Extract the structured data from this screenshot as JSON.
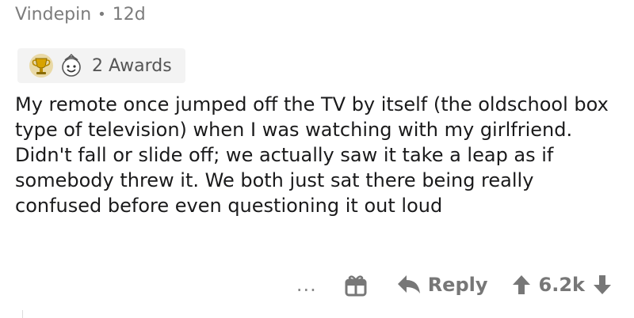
{
  "comment": {
    "author": "Vindepin",
    "separator": "•",
    "age": "12d",
    "awards": {
      "icons": [
        "gold-trophy-award-icon",
        "wholesome-seal-award-icon"
      ],
      "label": "2 Awards"
    },
    "body": "My remote once jumped off the TV by itself (the oldschool box type of television) when I was watching with my girlfriend. Didn't fall or slide off; we actually saw it take a leap as if somebody threw it. We both just sat there being really confused before even questioning it out loud",
    "actions": {
      "more": "...",
      "gift_icon": "gift-icon",
      "reply_icon": "reply-arrow-icon",
      "reply_label": "Reply",
      "upvote_icon": "upvote-arrow-icon",
      "score": "6.2k",
      "downvote_icon": "downvote-arrow-icon"
    }
  },
  "colors": {
    "meta_text": "#7c7c7c",
    "awards_bg": "#f3f3f3",
    "body_text": "#1a1a1b",
    "action_text": "#777777"
  }
}
